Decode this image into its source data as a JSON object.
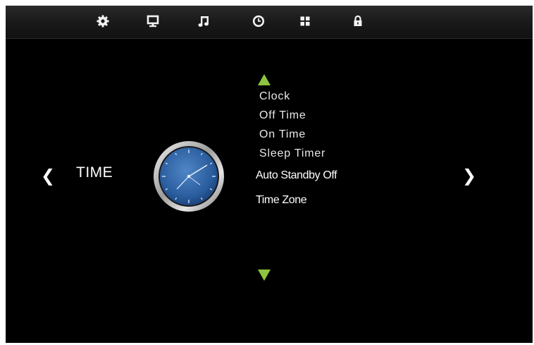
{
  "tabs": [
    {
      "icon": "gear-icon"
    },
    {
      "icon": "monitor-icon"
    },
    {
      "icon": "music-note-icon"
    },
    {
      "icon": "clock-icon"
    },
    {
      "icon": "grid-icon"
    },
    {
      "icon": "lock-icon"
    }
  ],
  "nav": {
    "left_glyph": "❮",
    "right_glyph": "❯"
  },
  "section": {
    "title": "TIME",
    "icon": "analog-clock-icon"
  },
  "menu": {
    "items": [
      {
        "label": "Clock"
      },
      {
        "label": "Off Time"
      },
      {
        "label": "On Time"
      },
      {
        "label": "Sleep Timer"
      },
      {
        "label": "Auto Standby Off"
      },
      {
        "label": "Time Zone"
      }
    ],
    "scroll_up": "up-arrow-icon",
    "scroll_down": "down-arrow-icon"
  },
  "colors": {
    "background": "#000000",
    "accent": "#8fc440",
    "text": "#ffffff",
    "clock_face": "#2f63a8"
  }
}
